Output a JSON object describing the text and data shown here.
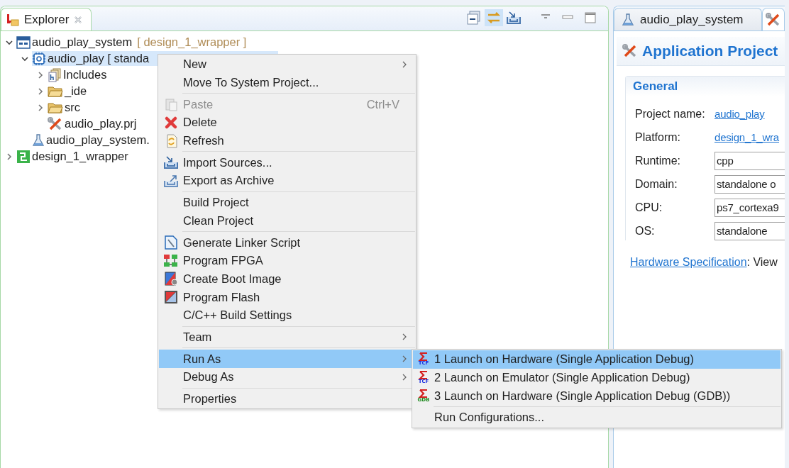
{
  "explorer": {
    "tab": {
      "title": "Explorer",
      "selected": true
    },
    "tree": [
      {
        "label": "audio_play_system",
        "suffix": "[ design_1_wrapper ]",
        "kind": "system",
        "expanded": true,
        "selected": false,
        "children": [
          {
            "label": "audio_play [ standa",
            "kind": "application",
            "expanded": true,
            "selected": true,
            "children": [
              {
                "label": "Includes",
                "kind": "includes",
                "expanded": false,
                "selected": false
              },
              {
                "label": "_ide",
                "kind": "folder",
                "expanded": false,
                "selected": false
              },
              {
                "label": "src",
                "kind": "folder",
                "expanded": false,
                "selected": false
              },
              {
                "label": "audio_play.prj",
                "kind": "project_file",
                "selected": false
              }
            ]
          },
          {
            "label": "audio_play_system.",
            "kind": "system_file",
            "selected": false
          }
        ]
      },
      {
        "label": "design_1_wrapper",
        "kind": "platform",
        "expanded": false,
        "selected": false
      }
    ]
  },
  "context_menu": {
    "groups": [
      [
        {
          "label": "New",
          "submenu": true,
          "disabled": false,
          "selected": false
        },
        {
          "label": "Move To System Project...",
          "submenu": false,
          "disabled": false,
          "selected": false
        }
      ],
      [
        {
          "label": "Paste",
          "shortcut": "Ctrl+V",
          "submenu": false,
          "disabled": true,
          "selected": false
        },
        {
          "label": "Delete",
          "submenu": false,
          "disabled": false,
          "selected": false
        },
        {
          "label": "Refresh",
          "submenu": false,
          "disabled": false,
          "selected": false
        }
      ],
      [
        {
          "label": "Import Sources...",
          "submenu": false,
          "disabled": false,
          "selected": false
        },
        {
          "label": "Export as Archive",
          "submenu": false,
          "disabled": false,
          "selected": false
        }
      ],
      [
        {
          "label": "Build Project",
          "submenu": false,
          "disabled": false,
          "selected": false
        },
        {
          "label": "Clean Project",
          "submenu": false,
          "disabled": false,
          "selected": false
        }
      ],
      [
        {
          "label": "Generate Linker Script",
          "submenu": false,
          "disabled": false,
          "selected": false
        },
        {
          "label": "Program FPGA",
          "submenu": false,
          "disabled": false,
          "selected": false
        },
        {
          "label": "Create Boot Image",
          "submenu": false,
          "disabled": false,
          "selected": false
        },
        {
          "label": "Program Flash",
          "submenu": false,
          "disabled": false,
          "selected": false
        },
        {
          "label": "C/C++ Build Settings",
          "submenu": false,
          "disabled": false,
          "selected": false
        }
      ],
      [
        {
          "label": "Team",
          "submenu": true,
          "disabled": false,
          "selected": false
        }
      ],
      [
        {
          "label": "Run As",
          "submenu": true,
          "disabled": false,
          "selected": true
        },
        {
          "label": "Debug As",
          "submenu": true,
          "disabled": false,
          "selected": false
        }
      ],
      [
        {
          "label": "Properties",
          "submenu": false,
          "disabled": false,
          "selected": false
        }
      ]
    ]
  },
  "run_as_submenu": {
    "groups": [
      [
        {
          "label": "1 Launch on Hardware (Single Application Debug)",
          "icon_label": "TCF",
          "color": "#1a2ee0",
          "selected": true
        },
        {
          "label": "2 Launch on Emulator (Single Application Debug)",
          "icon_label": "TCF",
          "color": "#1a2ee0",
          "selected": false
        },
        {
          "label": "3 Launch on Hardware (Single Application Debug (GDB))",
          "icon_label": "GDB",
          "color": "#1e8a1e",
          "selected": false
        }
      ],
      [
        {
          "label": "Run Configurations...",
          "selected": false
        }
      ]
    ]
  },
  "editor": {
    "tabs": [
      {
        "label": "audio_play_system",
        "selected": false
      },
      {
        "selected": true
      }
    ],
    "title": "Application Project",
    "section": {
      "title": "General",
      "rows": [
        {
          "label": "Project name:",
          "kind": "link",
          "value": "audio_play"
        },
        {
          "label": "Platform:",
          "kind": "link",
          "value": "design_1_wra"
        },
        {
          "label": "Runtime:",
          "kind": "field",
          "value": "cpp"
        },
        {
          "label": "Domain:",
          "kind": "field",
          "value": "standalone o"
        },
        {
          "label": "CPU:",
          "kind": "field",
          "value": "ps7_cortexa9"
        },
        {
          "label": "OS:",
          "kind": "field",
          "value": "standalone"
        }
      ]
    },
    "footer": {
      "link": "Hardware Specification",
      "text": ": View"
    }
  }
}
